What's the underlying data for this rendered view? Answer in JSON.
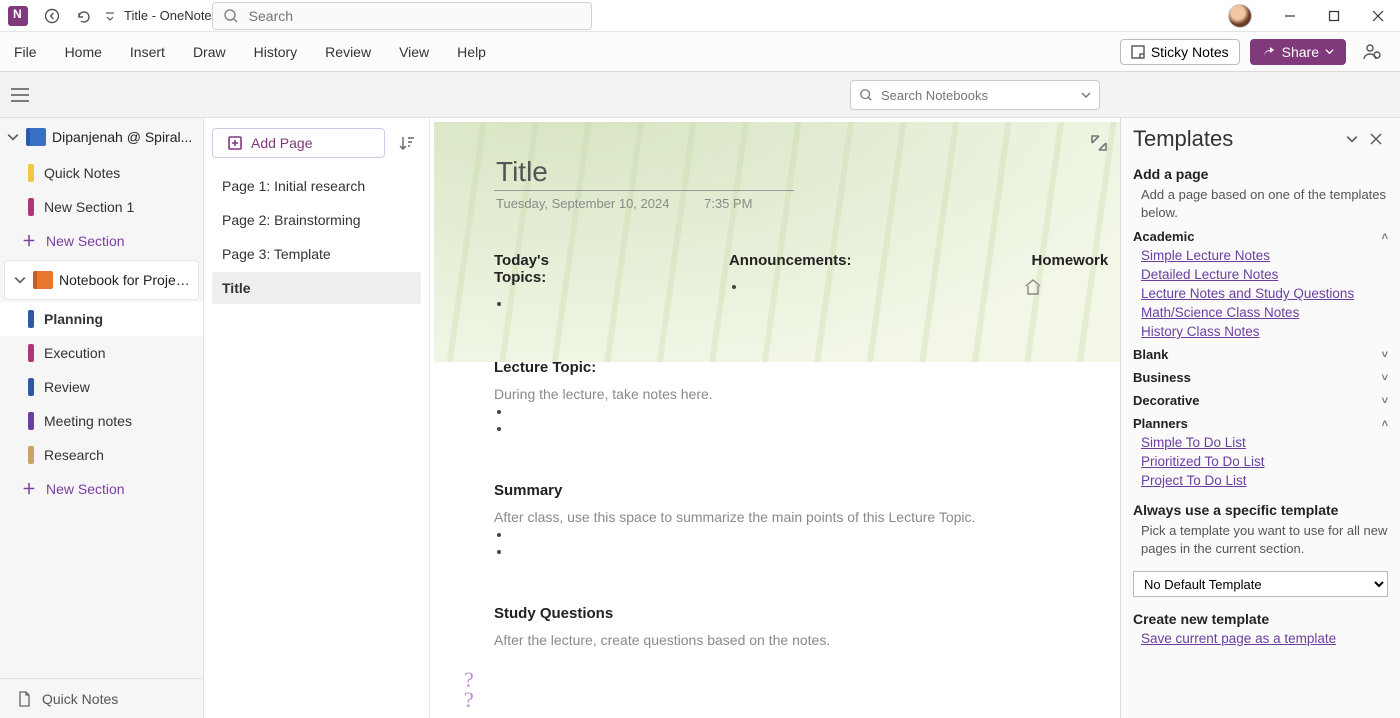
{
  "titlebar": {
    "doc_title": "Title  -  OneNote",
    "search_placeholder": "Search"
  },
  "window": {
    "minimize": "–",
    "maximize": "▢",
    "close": "✕"
  },
  "ribbon": {
    "tabs": [
      "File",
      "Home",
      "Insert",
      "Draw",
      "History",
      "Review",
      "View",
      "Help"
    ],
    "sticky": "Sticky Notes",
    "share": "Share"
  },
  "subbar": {
    "notebook_search_placeholder": "Search Notebooks"
  },
  "nav": {
    "notebook1": {
      "name": "Dipanjenah @ Spiral..."
    },
    "sections1": [
      {
        "label": "Quick Notes",
        "color": "#f2c744"
      },
      {
        "label": "New Section 1",
        "color": "#b2357b"
      }
    ],
    "new_section": "New Section",
    "notebook2": {
      "name": "Notebook for Project A"
    },
    "sections2": [
      {
        "label": "Planning",
        "color": "#3158a8",
        "selected": true
      },
      {
        "label": "Execution",
        "color": "#b2357b"
      },
      {
        "label": "Review",
        "color": "#3158a8"
      },
      {
        "label": "Meeting notes",
        "color": "#6b3fa0"
      },
      {
        "label": "Research",
        "color": "#c9a36a"
      }
    ],
    "footer": "Quick Notes"
  },
  "pages": {
    "add": "Add Page",
    "items": [
      {
        "label": "Page 1: Initial research"
      },
      {
        "label": "Page 2: Brainstorming"
      },
      {
        "label": "Page 3: Template"
      },
      {
        "label": "Title",
        "selected": true
      }
    ]
  },
  "note": {
    "title": "Title",
    "date": "Tuesday, September 10, 2024",
    "time": "7:35 PM",
    "topics_h": "Today's Topics:",
    "ann_h": "Announcements:",
    "hw_h": "Homework",
    "lecture_h": "Lecture Topic:",
    "lecture_sub": "During the lecture, take notes here.",
    "summary_h": "Summary",
    "summary_sub": "After class, use this space to summarize the main points of this Lecture Topic.",
    "sq_h": "Study Questions",
    "sq_sub": "After the lecture, create questions based on the notes."
  },
  "templates": {
    "title": "Templates",
    "add_h": "Add a page",
    "add_desc": "Add a page based on one of the templates below.",
    "academic": "Academic",
    "academic_items": [
      "Simple Lecture Notes",
      "Detailed Lecture Notes",
      "Lecture Notes and Study Questions",
      "Math/Science Class Notes",
      "History Class Notes"
    ],
    "blank": "Blank",
    "business": "Business",
    "decorative": "Decorative",
    "planners": "Planners",
    "planner_items": [
      "Simple To Do List",
      "Prioritized To Do List",
      "Project To Do List"
    ],
    "always_h": "Always use a specific template",
    "always_desc": "Pick a template you want to use for all new pages in the current section.",
    "default_option": "No Default Template",
    "create_h": "Create new template",
    "save_link": "Save current page as a template"
  }
}
